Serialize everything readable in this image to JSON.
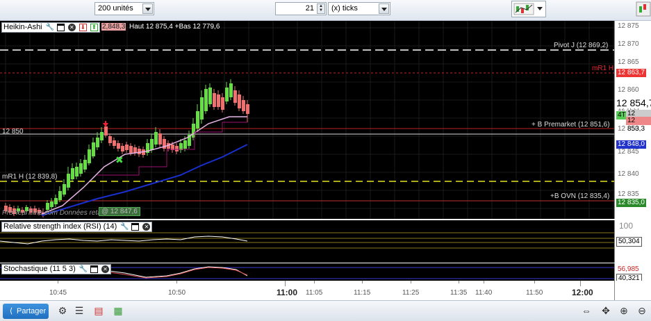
{
  "toolbar": {
    "units": "200 unités",
    "ticks_value": "21",
    "ticks_unit": "(x) ticks"
  },
  "main_chart": {
    "indicator": "Heikin-Ashi",
    "ohlc_fragment": "2,848,3",
    "high_low": "Haut 12 875,4 +Bas 12 779,6",
    "y_ticks": [
      "12 875",
      "12 870",
      "12 865",
      "12 860",
      "12 855",
      "12 850",
      "12 845",
      "12 840",
      "12 835"
    ],
    "levels": {
      "pivot": "Pivot J (12 869,2)",
      "mr1h_top": "mR1 H",
      "mr1h_top_price": "12 863,7",
      "line_12850": "12 850",
      "premarket": "+ B Premarket (12 851,6)",
      "mr1h_low": "mR1 H (12 839,8)",
      "ovn": "+B OVN (12 835,4)",
      "ovn_price": "12 835,0"
    },
    "price_tags": {
      "current_big": "12 854,7",
      "tag_a": "4T",
      "tag_b": "12 854,6",
      "tag_c": "12 853,3",
      "tag_d": "12 848,0"
    },
    "watermark": "ProRealTime.com  Données retardées",
    "box_label": "@ 12 847,6"
  },
  "rsi": {
    "title": "Relative strength index (RSI) (14)",
    "axis_top": "100",
    "value": "50,304"
  },
  "stoch": {
    "title": "Stochastique (11 5 3)",
    "value_a": "56,985",
    "value_b": "40,321"
  },
  "x_axis": {
    "ticks": [
      {
        "t": "10:45",
        "bold": false
      },
      {
        "t": "10:50",
        "bold": false
      },
      {
        "t": "11:00",
        "bold": true
      },
      {
        "t": "11:05",
        "bold": false
      },
      {
        "t": "11:15",
        "bold": false
      },
      {
        "t": "11:25",
        "bold": false
      },
      {
        "t": "11:35",
        "bold": false
      },
      {
        "t": "11:40",
        "bold": false
      },
      {
        "t": "11:50",
        "bold": false
      },
      {
        "t": "12:00",
        "bold": true
      }
    ]
  },
  "bottom": {
    "share_label": "Partager"
  },
  "colors": {
    "bull": "#66dd44",
    "bear": "#f07070",
    "ma_fast": "#e8b4e8",
    "ma_slow": "#1a2fd0",
    "pivot_line": "#ffffff",
    "r1_line": "#cc2222",
    "support_line": "#e6e620"
  }
}
